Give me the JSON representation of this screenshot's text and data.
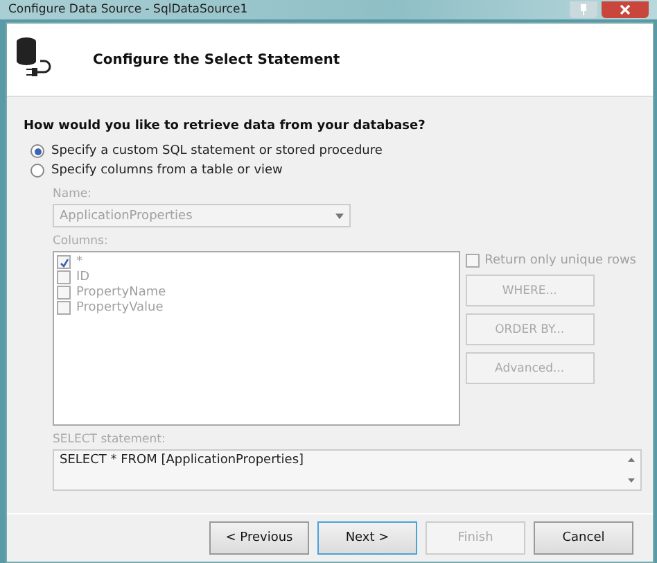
{
  "window": {
    "title": "Configure Data Source - SqlDataSource1"
  },
  "header": {
    "title": "Configure the Select Statement"
  },
  "question": "How would you like to retrieve data from your database?",
  "options": [
    {
      "label": "Specify a custom SQL statement or stored procedure",
      "selected": true
    },
    {
      "label": "Specify columns from a table or view",
      "selected": false
    }
  ],
  "name_field": {
    "label": "Name:",
    "value": "ApplicationProperties",
    "disabled": true
  },
  "columns": {
    "label": "Columns:",
    "disabled": true,
    "items": [
      {
        "label": "*",
        "checked": true
      },
      {
        "label": "ID",
        "checked": false
      },
      {
        "label": "PropertyName",
        "checked": false
      },
      {
        "label": "PropertyValue",
        "checked": false
      }
    ]
  },
  "unique_rows": {
    "label": "Return only unique rows",
    "checked": false,
    "disabled": true
  },
  "side_buttons": [
    {
      "label": "WHERE...",
      "disabled": true
    },
    {
      "label": "ORDER BY...",
      "disabled": true
    },
    {
      "label": "Advanced...",
      "disabled": true
    }
  ],
  "select_statement": {
    "label": "SELECT statement:",
    "value": "SELECT * FROM [ApplicationProperties]"
  },
  "buttons": [
    {
      "label": "< Previous",
      "disabled": false,
      "focused": false
    },
    {
      "label": "Next >",
      "disabled": false,
      "focused": true
    },
    {
      "label": "Finish",
      "disabled": true,
      "focused": false
    },
    {
      "label": "Cancel",
      "disabled": false,
      "focused": false
    }
  ]
}
